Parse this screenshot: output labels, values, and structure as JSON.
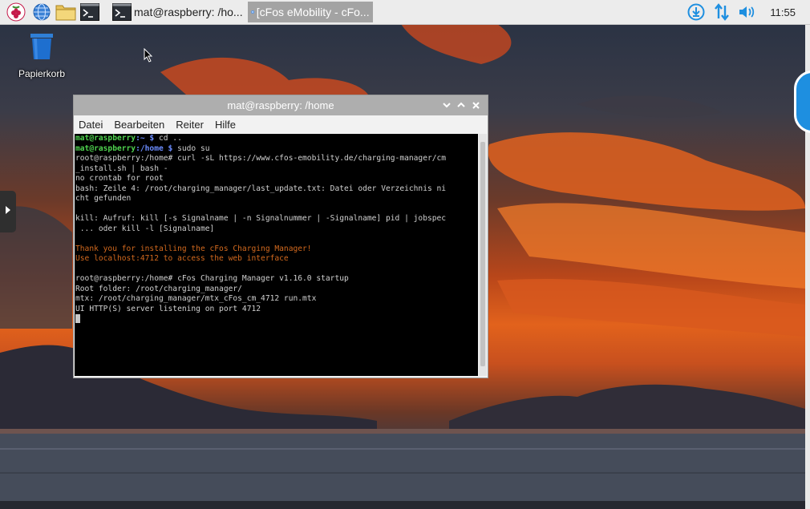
{
  "taskbar": {
    "tasks": [
      {
        "label": "mat@raspberry: /ho...",
        "icon": "terminal-icon",
        "active": false
      },
      {
        "label": "[cFos eMobility - cFo...",
        "icon": "chromium-icon",
        "active": true
      }
    ],
    "clock": "11:55",
    "tray_icons": [
      "download-icon",
      "network-transfer-icon",
      "volume-icon"
    ]
  },
  "desktop": {
    "trash_label": "Papierkorb"
  },
  "terminal": {
    "title": "mat@raspberry: /home",
    "menu": [
      "Datei",
      "Bearbeiten",
      "Reiter",
      "Hilfe"
    ],
    "lines": {
      "l1_user": "mat@raspberry",
      "l1_path": ":~ $",
      "l1_cmd": " cd ..",
      "l2_user": "mat@raspberry",
      "l2_path": ":/home $",
      "l2_cmd": " sudo su",
      "l3": "root@raspberry:/home# curl -sL https://www.cfos-emobility.de/charging-manager/cm",
      "l4": "_install.sh | bash -",
      "l5": "no crontab for root",
      "l6": "bash: Zeile 4: /root/charging_manager/last_update.txt: Datei oder Verzeichnis ni",
      "l7": "cht gefunden",
      "l8": "",
      "l9": "kill: Aufruf: kill [-s Signalname | -n Signalnummer | -Signalname] pid | jobspec",
      "l10": " ... oder kill -l [Signalname]",
      "l11": "",
      "l12": "Thank you for installing the cFos Charging Manager!",
      "l13": "Use localhost:4712 to access the web interface",
      "l14": "",
      "l15": "root@raspberry:/home# cFos Charging Manager v1.16.0 startup",
      "l16": "Root folder: /root/charging_manager/",
      "l17": "mtx: /root/charging_manager/mtx_cFos_cm_4712 run.mtx",
      "l18": "UI HTTP(S) server listening on port 4712"
    }
  },
  "colors": {
    "prompt_user": "#4fd34f",
    "prompt_path": "#6b8cff",
    "highlight": "#d2691e",
    "taskbar_active": "#a3a3a3"
  }
}
